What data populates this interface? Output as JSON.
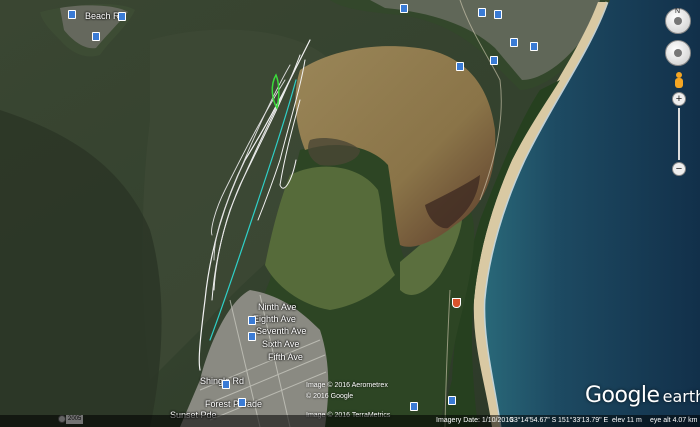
{
  "map": {
    "place_labels": [
      {
        "text": "Beach Rd"
      },
      {
        "text": "Ninth Ave"
      },
      {
        "text": "Eighth Ave"
      },
      {
        "text": "Seventh Ave"
      },
      {
        "text": "Sixth Ave"
      },
      {
        "text": "Fifth Ave"
      },
      {
        "text": "Shingle Rd"
      },
      {
        "text": "Forest Parade"
      },
      {
        "text": "Sunset Pde"
      }
    ],
    "route_shield": "",
    "year_marker": "2005"
  },
  "copyright": {
    "line1": "Image © 2016 Aerometrex",
    "line2": "© 2016 Google",
    "line3": "Image © 2016 TerraMetrics"
  },
  "logo": {
    "google": "Google",
    "earth": "earth"
  },
  "status_bar": {
    "imagery_date": "Imagery Date: 1/10/2016",
    "latitude": "33°14'54.67\" S",
    "longitude": "151°33'13.79\" E",
    "elevation": "elev   11 m",
    "eye_alt": "eye alt   4.07 km"
  },
  "nav": {
    "north": "N",
    "zoom_in": "+",
    "zoom_out": "−"
  },
  "colors": {
    "water_dark": "#2c3a28",
    "lagoon": "#8a7448",
    "land_green": "#2f4a25",
    "ocean": "#17314a",
    "beach": "#d9c9a3",
    "track_white": "#f2f2f2",
    "track_cyan": "#2fd0c8",
    "track_green": "#3bdc3b"
  }
}
